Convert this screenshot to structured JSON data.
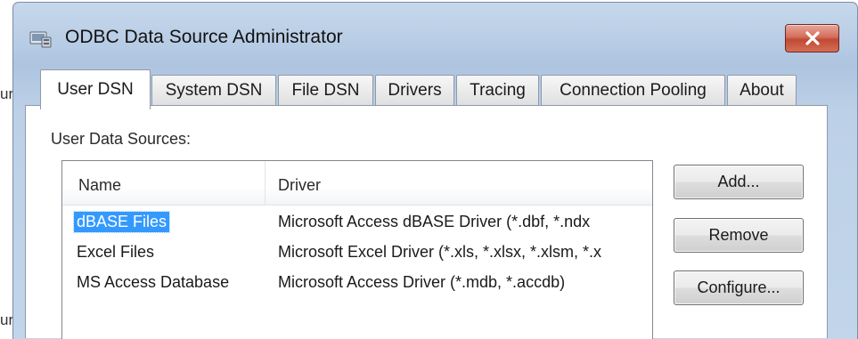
{
  "background_fragments": [
    "ur",
    "ur"
  ],
  "window": {
    "title": "ODBC Data Source Administrator",
    "close_icon": "close-x-icon",
    "app_icon": "odbc-admin-icon"
  },
  "tabs": [
    {
      "label": "User DSN",
      "active": true
    },
    {
      "label": "System DSN",
      "active": false
    },
    {
      "label": "File DSN",
      "active": false
    },
    {
      "label": "Drivers",
      "active": false
    },
    {
      "label": "Tracing",
      "active": false
    },
    {
      "label": "Connection Pooling",
      "active": false
    },
    {
      "label": "About",
      "active": false
    }
  ],
  "section_label": "User Data Sources:",
  "list": {
    "columns": {
      "name": "Name",
      "driver": "Driver"
    },
    "rows": [
      {
        "name": "dBASE Files",
        "driver": "Microsoft Access dBASE Driver (*.dbf, *.ndx",
        "selected": true
      },
      {
        "name": "Excel Files",
        "driver": "Microsoft Excel Driver (*.xls, *.xlsx, *.xlsm, *.x",
        "selected": false
      },
      {
        "name": "MS Access Database",
        "driver": "Microsoft Access Driver (*.mdb, *.accdb)",
        "selected": false
      }
    ]
  },
  "buttons": {
    "add": "Add...",
    "remove": "Remove",
    "configure": "Configure..."
  },
  "colors": {
    "selection": "#3399ff",
    "close_button": "#c9553f",
    "window_frame": "#b6cbe4"
  }
}
